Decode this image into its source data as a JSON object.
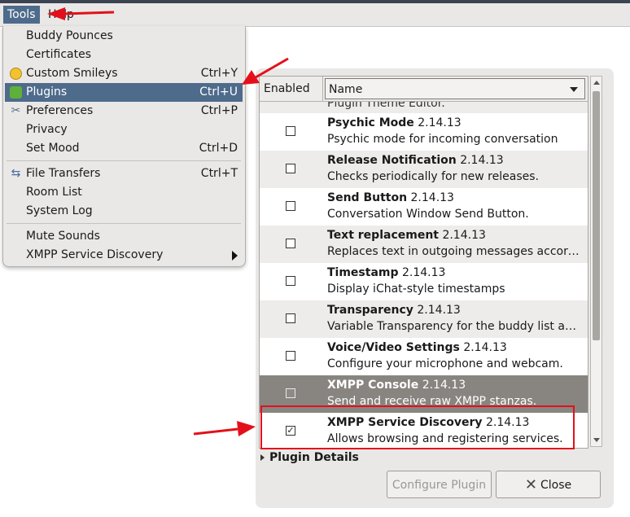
{
  "menubar": {
    "items": [
      {
        "label": "Tools"
      },
      {
        "label": "Help"
      }
    ]
  },
  "tools_menu": {
    "items": [
      {
        "label": "Buddy Pounces",
        "accel": ""
      },
      {
        "label": "Certificates",
        "accel": ""
      },
      {
        "label": "Custom Smileys",
        "accel": "Ctrl+Y",
        "icon": "smiley-icon"
      },
      {
        "label": "Plugins",
        "accel": "Ctrl+U",
        "icon": "puzzle-icon"
      },
      {
        "label": "Preferences",
        "accel": "Ctrl+P",
        "icon": "preferences-icon"
      },
      {
        "label": "Privacy",
        "accel": ""
      },
      {
        "label": "Set Mood",
        "accel": "Ctrl+D"
      },
      {
        "label": "File Transfers",
        "accel": "Ctrl+T",
        "icon": "file-transfer-icon"
      },
      {
        "label": "Room List",
        "accel": ""
      },
      {
        "label": "System Log",
        "accel": ""
      },
      {
        "label": "Mute Sounds",
        "accel": ""
      },
      {
        "label": "XMPP Service Discovery",
        "accel": ""
      }
    ]
  },
  "plugins": {
    "columns": {
      "enabled": "Enabled",
      "name": "Name"
    },
    "partial_row": "Plugin Theme Editor.",
    "rows": [
      {
        "name": "Psychic Mode",
        "version": "2.14.13",
        "desc": "Psychic mode for incoming conversation",
        "checked": false
      },
      {
        "name": "Release Notification",
        "version": "2.14.13",
        "desc": "Checks periodically for new releases.",
        "checked": false
      },
      {
        "name": "Send Button",
        "version": "2.14.13",
        "desc": "Conversation Window Send Button.",
        "checked": false
      },
      {
        "name": "Text replacement",
        "version": "2.14.13",
        "desc": "Replaces text in outgoing messages according to user-defined rules.",
        "checked": false
      },
      {
        "name": "Timestamp",
        "version": "2.14.13",
        "desc": "Display iChat-style timestamps",
        "checked": false
      },
      {
        "name": "Transparency",
        "version": "2.14.13",
        "desc": "Variable Transparency for the buddy list and conversations.",
        "checked": false
      },
      {
        "name": "Voice/Video Settings",
        "version": "2.14.13",
        "desc": "Configure your microphone and webcam.",
        "checked": false
      },
      {
        "name": "XMPP Console",
        "version": "2.14.13",
        "desc": "Send and receive raw XMPP stanzas.",
        "checked": false
      },
      {
        "name": "XMPP Service Discovery",
        "version": "2.14.13",
        "desc": "Allows browsing and registering services.",
        "checked": true
      }
    ],
    "details_label": "Plugin Details",
    "configure_label": "Configure Plugin",
    "close_label": "Close"
  },
  "colors": {
    "menu_highlight": "#4e6b8c",
    "selected_row": "#888580",
    "annotation_red": "#e3101b"
  }
}
